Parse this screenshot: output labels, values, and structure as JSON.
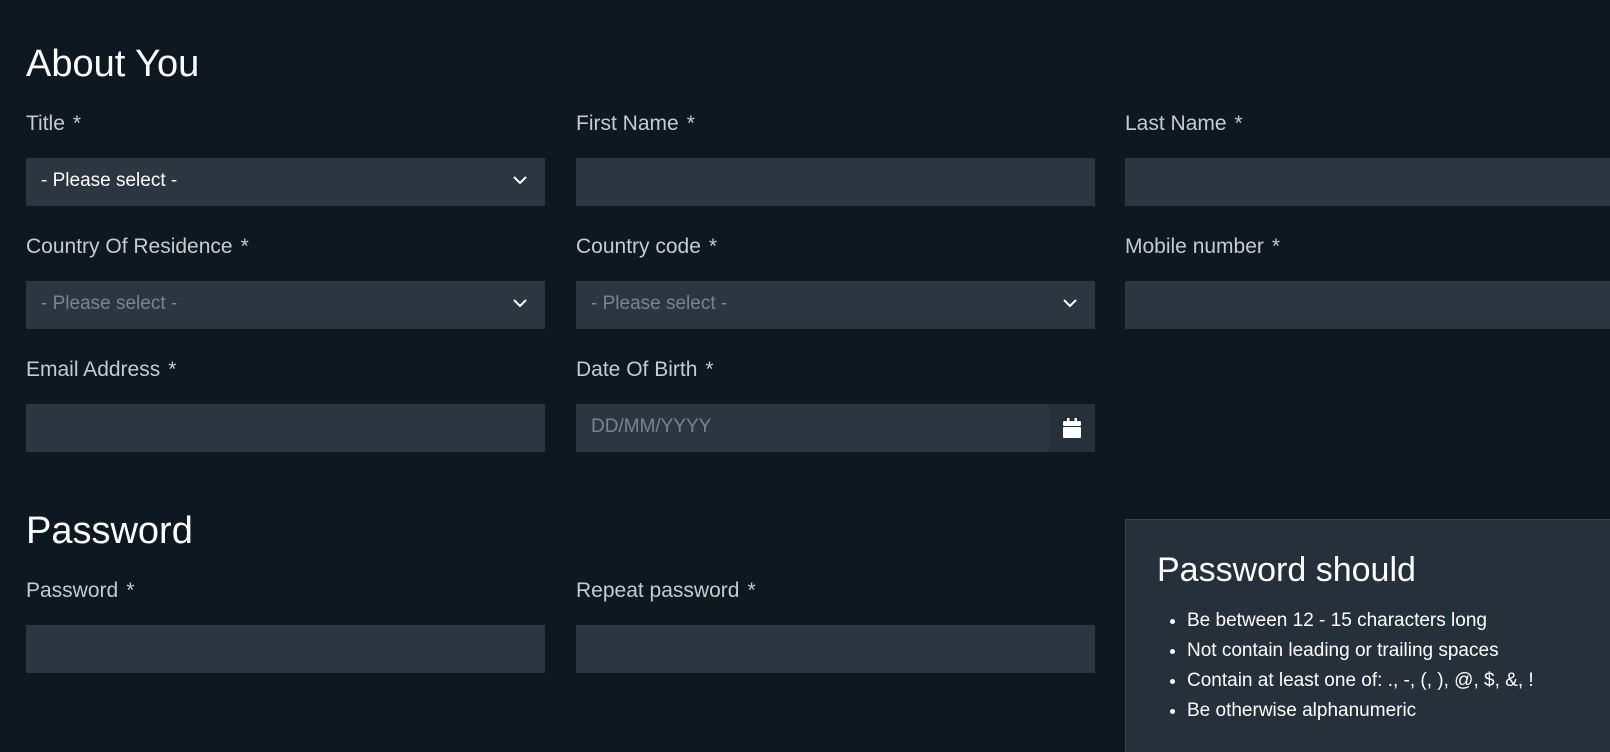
{
  "about": {
    "heading": "About You",
    "title_field": {
      "label": "Title",
      "required": "*",
      "value": "- Please select -"
    },
    "first_name": {
      "label": "First Name",
      "required": "*",
      "value": ""
    },
    "last_name": {
      "label": "Last Name",
      "required": "*",
      "value": ""
    },
    "country_residence": {
      "label": "Country Of Residence",
      "required": "*",
      "placeholder": "- Please select -"
    },
    "country_code": {
      "label": "Country code",
      "required": "*",
      "placeholder": "- Please select -"
    },
    "mobile": {
      "label": "Mobile number",
      "required": "*",
      "value": ""
    },
    "email": {
      "label": "Email Address",
      "required": "*",
      "value": ""
    },
    "dob": {
      "label": "Date Of Birth",
      "required": "*",
      "placeholder": "DD/MM/YYYY",
      "icon": "calendar-icon"
    }
  },
  "password": {
    "heading": "Password",
    "password_field": {
      "label": "Password",
      "required": "*",
      "value": ""
    },
    "repeat_field": {
      "label": "Repeat password",
      "required": "*",
      "value": ""
    },
    "rules": {
      "title": "Password should",
      "items": [
        "Be between 12 - 15 characters long",
        "Not contain leading or trailing spaces",
        "Contain at least one of: ., -, (, ), @, $, &, !",
        "Be otherwise alphanumeric"
      ]
    }
  },
  "colors": {
    "background": "#0e1821",
    "field_background": "#2c3640",
    "label": "#c5cbd1",
    "placeholder": "#7a848d"
  }
}
